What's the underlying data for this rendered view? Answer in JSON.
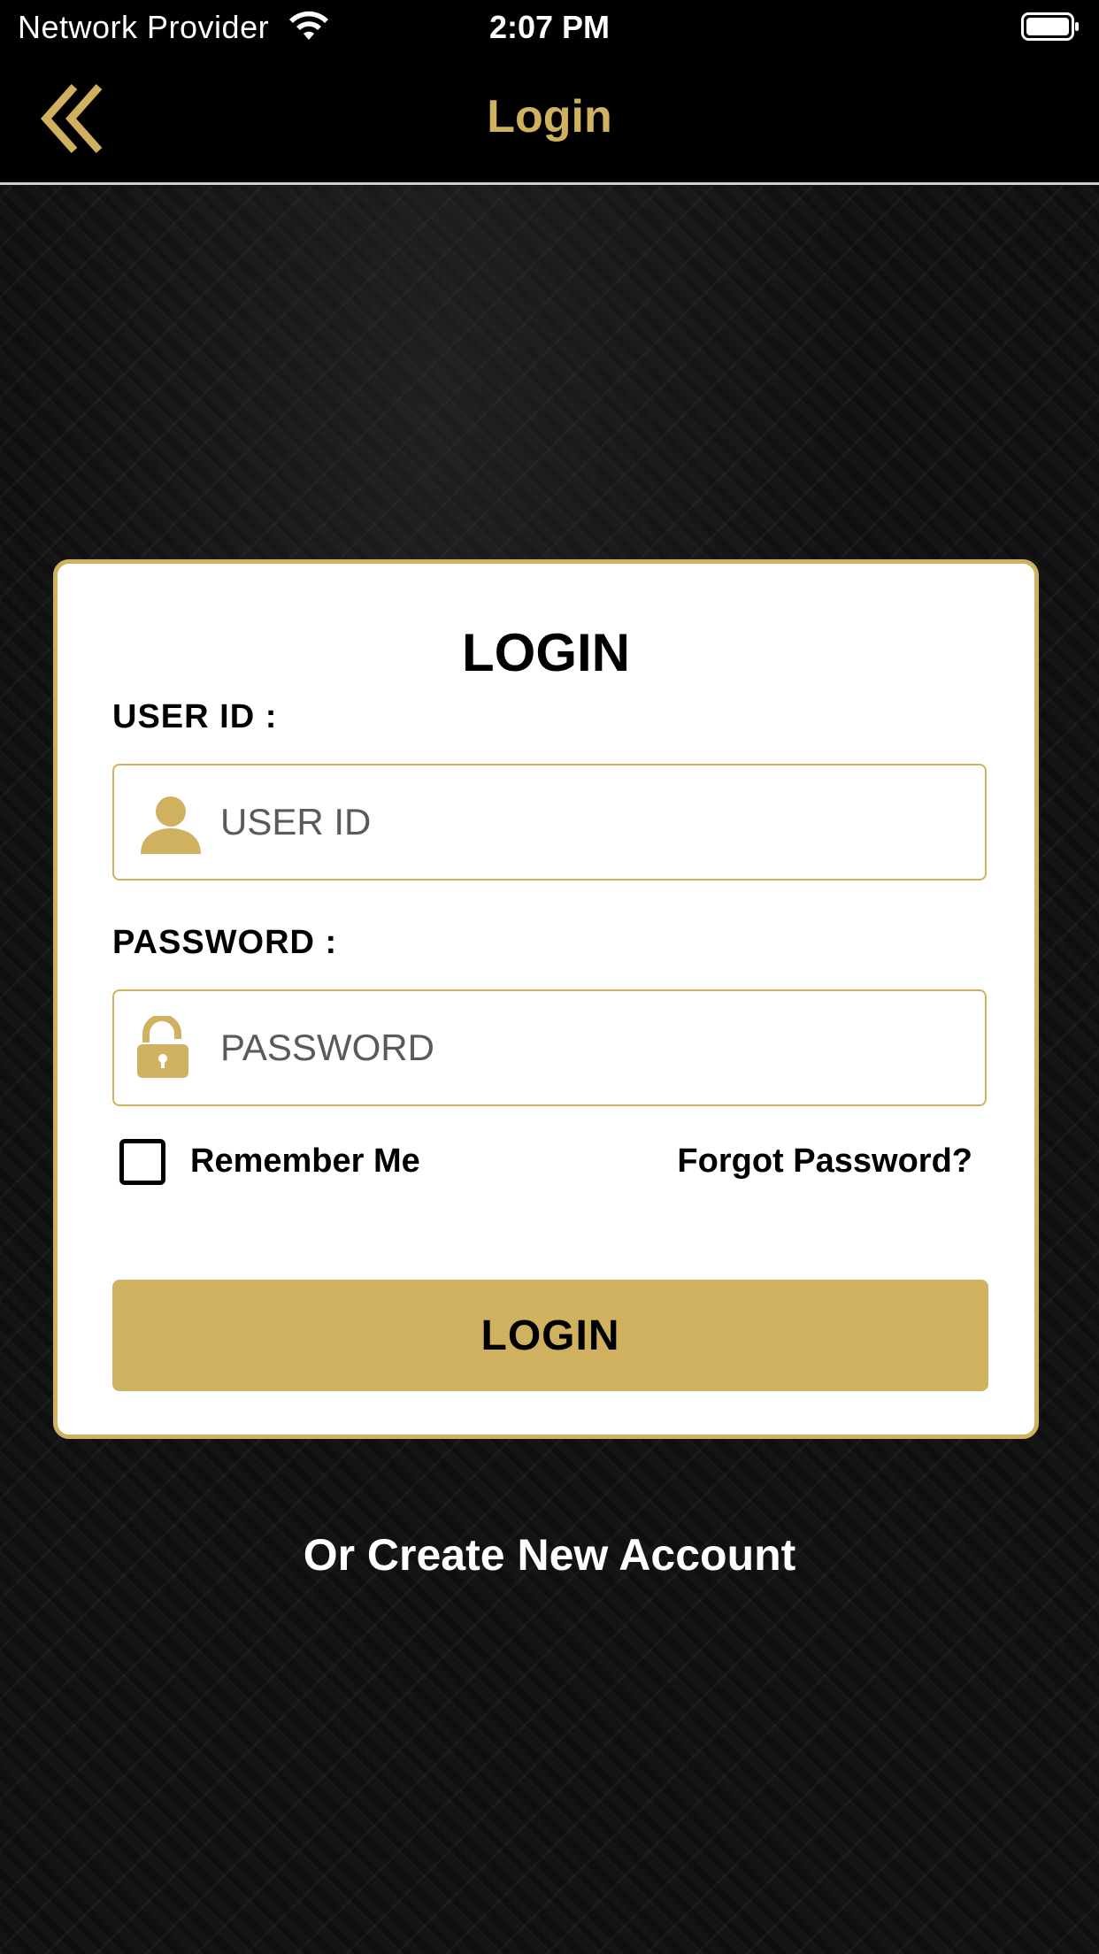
{
  "status_bar": {
    "carrier": "Network Provider",
    "time": "2:07 PM",
    "wifi_icon": "wifi-icon",
    "battery_icon": "battery-icon"
  },
  "nav": {
    "title": "Login",
    "back_icon": "double-chevron-left-icon"
  },
  "login_card": {
    "title": "LOGIN",
    "user_id": {
      "label": "USER ID :",
      "placeholder": "USER ID",
      "value": "",
      "icon": "user-icon"
    },
    "password": {
      "label": "PASSWORD :",
      "placeholder": "PASSWORD",
      "value": "",
      "icon": "unlocked-padlock-icon"
    },
    "remember_me": {
      "label": "Remember Me",
      "checked": false
    },
    "forgot_password": "Forgot Password?",
    "login_button": "LOGIN"
  },
  "create_account": "Or Create New Account",
  "colors": {
    "accent_gold": "#cfb15f",
    "background": "#141414",
    "nav_background": "#000000",
    "card_background": "#ffffff"
  }
}
